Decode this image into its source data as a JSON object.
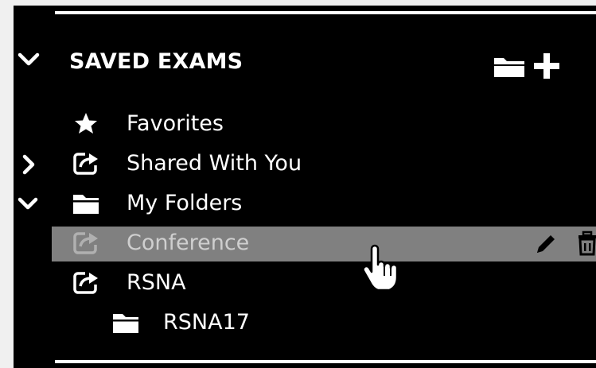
{
  "header": {
    "title": "SAVED EXAMS"
  },
  "items": [
    {
      "label": "Favorites",
      "icon": "star-icon"
    },
    {
      "label": "Shared With You",
      "icon": "shared-folder-icon",
      "expand": "collapsed"
    },
    {
      "label": "My Folders",
      "icon": "folder-icon",
      "expand": "expanded"
    },
    {
      "label": "Conference",
      "icon": "shared-folder-icon",
      "selected": true
    },
    {
      "label": "RSNA",
      "icon": "shared-folder-icon"
    },
    {
      "label": "RSNA17",
      "icon": "folder-icon"
    }
  ],
  "colors": {
    "background": "#000000",
    "text": "#ffffff",
    "highlight": "#808080"
  }
}
